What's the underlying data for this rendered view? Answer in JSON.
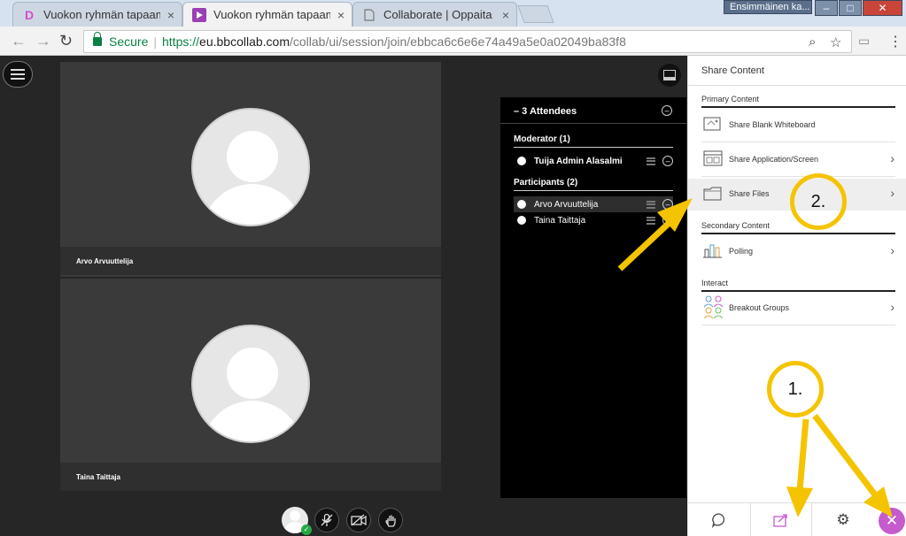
{
  "browser": {
    "tabs": [
      {
        "title": "Vuokon ryhmän tapaami",
        "favicon": "D",
        "favicon_color": "#d14fc8"
      },
      {
        "title": "Vuokon ryhmän tapaami",
        "favicon": "bb",
        "favicon_color": "#9b3fb5"
      },
      {
        "title": "Collaborate | Oppaita op",
        "favicon": "doc-icon",
        "favicon_color": "#777777"
      }
    ],
    "profile": "Ensimmäinen ka...",
    "tab_close": "×",
    "window_buttons": {
      "minimize": "–",
      "maximize": "□",
      "close": "✕"
    },
    "nav": {
      "back": "←",
      "forward": "→",
      "reload": "↻"
    },
    "secure_label": "Secure",
    "url_scheme": "https://",
    "url_host": "eu.bbcollab.com",
    "url_path": "/collab/ui/session/join/ebbca6c6e6e74a49a5e0a02049ba83f8",
    "zoom_icon": "⌕",
    "star_icon": "☆",
    "menu_icon": "⋮",
    "cast_icon": "▭"
  },
  "videos": [
    {
      "name": "Arvo Arvuuttelija"
    },
    {
      "name": "Taina Taittaja"
    }
  ],
  "attendees": {
    "header": "– 3 Attendees",
    "collapse_icon": "–",
    "moderator_title": "Moderator (1)",
    "moderators": [
      {
        "name": "Tuija Admin Alasalmi"
      }
    ],
    "participants_title": "Participants (2)",
    "participants": [
      {
        "name": "Arvo Arvuuttelija"
      },
      {
        "name": "Taina Taittaja"
      }
    ],
    "remove_icon": "–"
  },
  "media": {
    "mic_icon": "🎙",
    "camera_icon": "⌧",
    "hand_icon": "✋",
    "check_icon": "✓"
  },
  "panel": {
    "title": "Share Content",
    "primary_title": "Primary Content",
    "secondary_title": "Secondary Content",
    "interact_title": "Interact",
    "chevron": "›",
    "items": {
      "whiteboard": "Share Blank Whiteboard",
      "app_screen": "Share Application/Screen",
      "files": "Share Files",
      "polling": "Polling",
      "breakout": "Breakout Groups"
    },
    "tabs": {
      "chat_icon": "◯",
      "share_icon": "⇗",
      "settings_icon": "⚙",
      "close_icon": "✕"
    },
    "accent": "#c65bcd"
  },
  "annotations": {
    "step1": "1.",
    "step2": "2.",
    "color": "#f5c400"
  }
}
